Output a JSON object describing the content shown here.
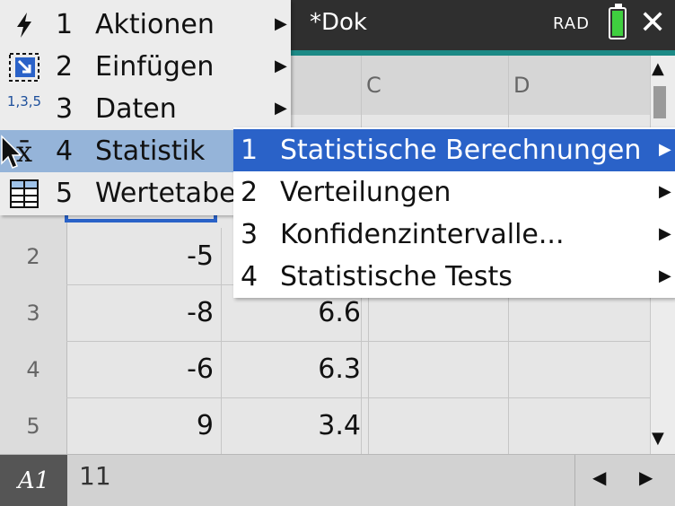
{
  "header": {
    "doc_title": "*Dok",
    "angle_mode": "RAD"
  },
  "columns": [
    "C",
    "D"
  ],
  "rows": [
    {
      "num": "2",
      "a": "-5",
      "b": ""
    },
    {
      "num": "3",
      "a": "-8",
      "b": "6.6"
    },
    {
      "num": "4",
      "a": "-6",
      "b": "6.3"
    },
    {
      "num": "5",
      "a": "9",
      "b": "3.4"
    }
  ],
  "entry_line": {
    "cell_ref": "A1",
    "value": "11"
  },
  "menu": {
    "items": [
      {
        "num": "1",
        "label": "Aktionen",
        "icon": "lightning-icon"
      },
      {
        "num": "2",
        "label": "Einfügen",
        "icon": "insert-icon"
      },
      {
        "num": "3",
        "label": "Daten",
        "icon": "data-sequence-icon",
        "icon_text": "1,3,5"
      },
      {
        "num": "4",
        "label": "Statistik",
        "icon": "x-bar-icon",
        "icon_text": "x̄"
      },
      {
        "num": "5",
        "label": "Wertetabe",
        "icon": "table-icon"
      }
    ]
  },
  "submenu": {
    "items": [
      {
        "num": "1",
        "label": "Statistische Berechnungen"
      },
      {
        "num": "2",
        "label": "Verteilungen"
      },
      {
        "num": "3",
        "label": "Konfidenzintervalle..."
      },
      {
        "num": "4",
        "label": "Statistische Tests"
      }
    ]
  },
  "colors": {
    "topbar": "#2f2f2f",
    "accent_teal": "#1c8a86",
    "menu_highlight": "#95b4d9",
    "submenu_highlight": "#2a62c8",
    "battery": "#3fcf3f"
  }
}
